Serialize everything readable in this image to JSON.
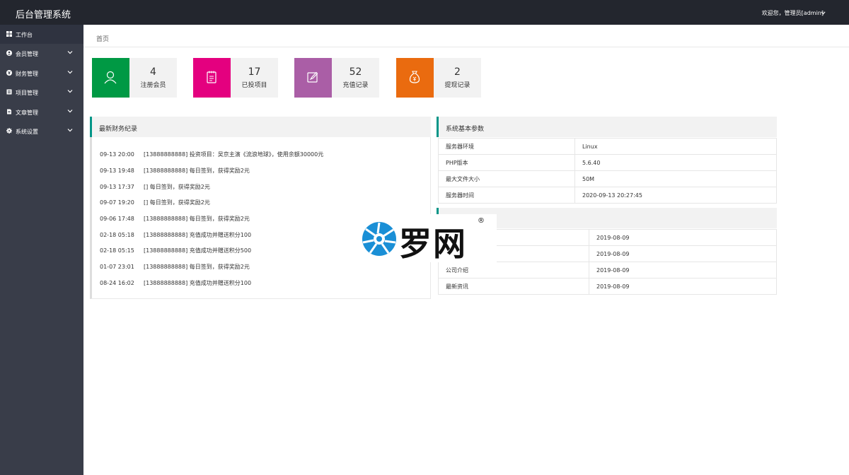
{
  "app": {
    "title": "后台管理系统",
    "user_greeting": "欢迎您，管理员[admin]"
  },
  "sidebar": {
    "items": [
      {
        "label": "工作台",
        "icon": "dashboard-icon",
        "has_submenu": false
      },
      {
        "label": "会员管理",
        "icon": "users-icon",
        "has_submenu": true
      },
      {
        "label": "财务管理",
        "icon": "money-icon",
        "has_submenu": true
      },
      {
        "label": "项目管理",
        "icon": "list-icon",
        "has_submenu": true
      },
      {
        "label": "文章管理",
        "icon": "document-icon",
        "has_submenu": true
      },
      {
        "label": "系统设置",
        "icon": "gear-icon",
        "has_submenu": true
      }
    ]
  },
  "breadcrumb": {
    "current": "首页"
  },
  "stats": [
    {
      "value": "4",
      "label": "注册会员",
      "color": "#009944",
      "icon": "user-icon"
    },
    {
      "value": "17",
      "label": "已投项目",
      "color": "#e4007f",
      "icon": "notepad-icon"
    },
    {
      "value": "52",
      "label": "充值记录",
      "color": "#aa5ea6",
      "icon": "edit-icon"
    },
    {
      "value": "2",
      "label": "提现记录",
      "color": "#ea6b0f",
      "icon": "money-bag-icon"
    }
  ],
  "finance": {
    "title": "最新财务纪录",
    "records": [
      {
        "time": "09-13 20:00",
        "text": "[13888888888] 投资项目：吴京主演《流浪地球》，使用余额30000元"
      },
      {
        "time": "09-13 19:48",
        "text": "[13888888888] 每日签到，获得奖励2元"
      },
      {
        "time": "09-13 17:37",
        "text": "[] 每日签到，获得奖励2元"
      },
      {
        "time": "09-07 19:20",
        "text": "[] 每日签到，获得奖励2元"
      },
      {
        "time": "09-06 17:48",
        "text": "[13888888888] 每日签到，获得奖励2元"
      },
      {
        "time": "02-18 05:18",
        "text": "[13888888888] 充值成功并赠送积分100"
      },
      {
        "time": "02-18 05:15",
        "text": "[13888888888] 充值成功并赠送积分500"
      },
      {
        "time": "01-07 23:01",
        "text": "[13888888888] 每日签到，获得奖励2元"
      },
      {
        "time": "08-24 16:02",
        "text": "[13888888888] 充值成功并赠送积分100"
      }
    ]
  },
  "system": {
    "title": "系统基本参数",
    "rows": [
      {
        "key": "服务器环境",
        "value": "Linux"
      },
      {
        "key": "PHP版本",
        "value": "5.6.40"
      },
      {
        "key": "最大文件大小",
        "value": "50M"
      },
      {
        "key": "服务器时间",
        "value": "2020-09-13 20:27:45"
      }
    ]
  },
  "pages": {
    "rows": [
      {
        "key": "",
        "value": "2019-08-09"
      },
      {
        "key": "",
        "value": "2019-08-09"
      },
      {
        "key": "公司介绍",
        "value": "2019-08-09"
      },
      {
        "key": "最新资讯",
        "value": "2019-08-09"
      }
    ]
  },
  "watermark": {
    "text": "罗网",
    "reg": "®"
  },
  "colors": {
    "topbar": "#23262e",
    "sidebar": "#393d49",
    "accent": "#009688"
  }
}
